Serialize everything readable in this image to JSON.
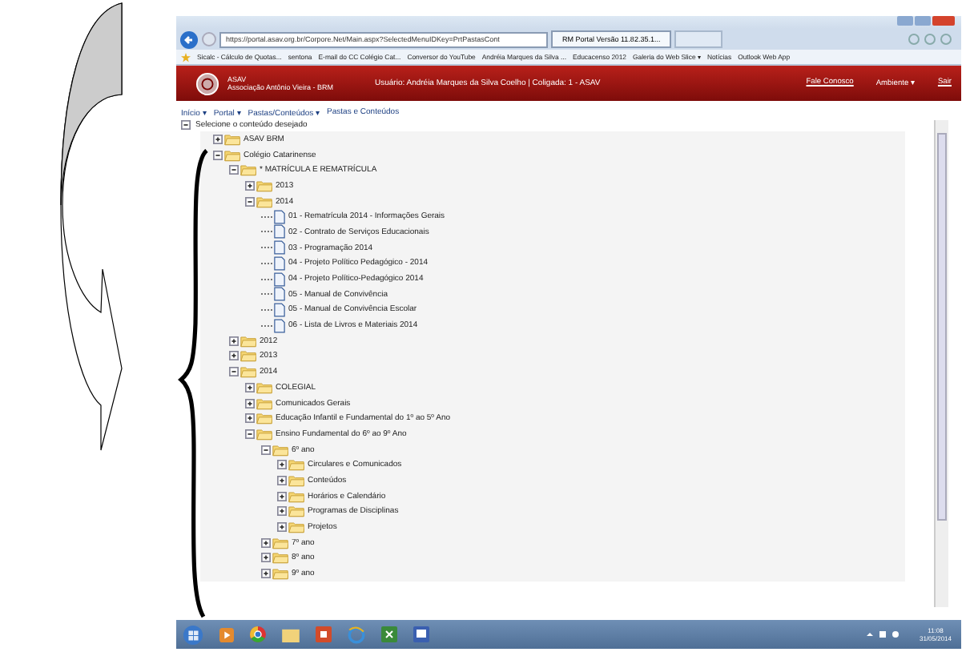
{
  "browser": {
    "address": "https://portal.asav.org.br/Corpore.Net/Main.aspx?SelectedMenuIDKey=PrtPastasCont",
    "tab_title": "RM Portal Versão 11.82.35.1...",
    "favorites": [
      "Sicalc - Cálculo de Quotas...",
      "sentona",
      "E-mail do CC Colégio Cat...",
      "Conversor do YouTube",
      "Andréia Marques da Silva ...",
      "Educacenso 2012",
      "Galeria do Web Slice ▾",
      "Notícias",
      "Outlook Web App"
    ]
  },
  "header": {
    "org_short": "ASAV",
    "org_name": "Associação Antônio Vieira - BRM",
    "user_info": "Usuário: Andréia Marques da Silva Coelho  |  Coligada: 1 - ASAV",
    "links": [
      "Fale Conosco",
      "Ambiente ▾",
      "Sair"
    ]
  },
  "breadcrumb": [
    "Início ▾",
    "Portal ▾",
    "Pastas/Conteúdos ▾",
    "Pastas e Conteúdos"
  ],
  "tree": {
    "root": "Selecione o conteúdo desejado",
    "items": [
      {
        "kind": "folder",
        "label": "ASAV BRM",
        "expanded": false
      },
      {
        "kind": "folder",
        "label": "Colégio Catarinense",
        "expanded": true,
        "children": [
          {
            "kind": "folder",
            "label": "* MATRÍCULA E REMATRÍCULA",
            "expanded": true,
            "children": [
              {
                "kind": "folder",
                "label": "2013",
                "expanded": false
              },
              {
                "kind": "folder",
                "label": "2014",
                "expanded": true,
                "children": [
                  {
                    "kind": "document",
                    "label": "01 - Rematrícula 2014 - Informações Gerais"
                  },
                  {
                    "kind": "document",
                    "label": "02 - Contrato de Serviços Educacionais"
                  },
                  {
                    "kind": "document",
                    "label": "03 - Programação 2014"
                  },
                  {
                    "kind": "document",
                    "label": "04 - Projeto Político Pedagógico - 2014"
                  },
                  {
                    "kind": "document",
                    "label": "04 - Projeto Político-Pedagógico 2014"
                  },
                  {
                    "kind": "document",
                    "label": "05 - Manual de Convivência"
                  },
                  {
                    "kind": "document",
                    "label": "05 - Manual de Convivência Escolar"
                  },
                  {
                    "kind": "document",
                    "label": "06 - Lista de Livros e Materiais 2014"
                  }
                ]
              }
            ]
          },
          {
            "kind": "folder",
            "label": "2012",
            "expanded": false
          },
          {
            "kind": "folder",
            "label": "2013",
            "expanded": false
          },
          {
            "kind": "folder",
            "label": "2014",
            "expanded": true,
            "children": [
              {
                "kind": "folder",
                "label": "COLEGIAL",
                "expanded": false
              },
              {
                "kind": "folder",
                "label": "Comunicados Gerais",
                "expanded": false
              },
              {
                "kind": "folder",
                "label": "Educação Infantil e Fundamental do 1º ao 5º Ano",
                "expanded": false
              },
              {
                "kind": "folder",
                "label": "Ensino Fundamental do 6º ao 9º Ano",
                "expanded": true,
                "children": [
                  {
                    "kind": "folder",
                    "label": "6º ano",
                    "expanded": true,
                    "children": [
                      {
                        "kind": "folder",
                        "label": "Circulares e Comunicados",
                        "expanded": false
                      },
                      {
                        "kind": "folder",
                        "label": "Conteúdos",
                        "expanded": false
                      },
                      {
                        "kind": "folder",
                        "label": "Horários e Calendário",
                        "expanded": false
                      },
                      {
                        "kind": "folder",
                        "label": "Programas de Disciplinas",
                        "expanded": false
                      },
                      {
                        "kind": "folder",
                        "label": "Projetos",
                        "expanded": false
                      }
                    ]
                  },
                  {
                    "kind": "folder",
                    "label": "7º ano",
                    "expanded": false
                  },
                  {
                    "kind": "folder",
                    "label": "8º ano",
                    "expanded": false
                  },
                  {
                    "kind": "folder",
                    "label": "9º ano",
                    "expanded": false
                  }
                ]
              }
            ]
          }
        ]
      }
    ]
  },
  "tray": {
    "time": "11:08",
    "date": "31/05/2014"
  }
}
